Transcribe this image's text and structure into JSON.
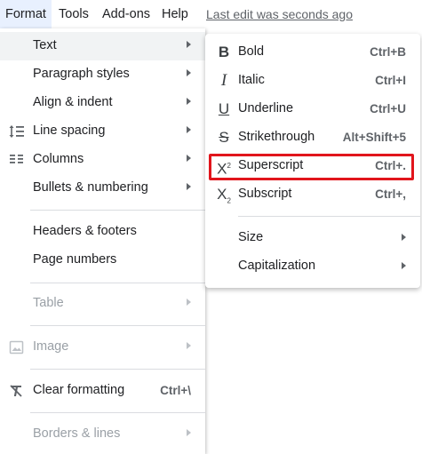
{
  "menubar": {
    "items": [
      "Format",
      "Tools",
      "Add-ons",
      "Help"
    ],
    "last_edit": "Last edit was seconds ago"
  },
  "format_menu": {
    "items": [
      {
        "label": "Text",
        "icon": "",
        "submenu": true,
        "state": "hover"
      },
      {
        "label": "Paragraph styles",
        "icon": "",
        "submenu": true
      },
      {
        "label": "Align & indent",
        "icon": "",
        "submenu": true
      },
      {
        "label": "Line spacing",
        "icon": "line-spacing-icon",
        "submenu": true
      },
      {
        "label": "Columns",
        "icon": "columns-icon",
        "submenu": true
      },
      {
        "label": "Bullets & numbering",
        "icon": "",
        "submenu": true
      },
      {
        "label": "Headers & footers",
        "icon": "",
        "submenu": false
      },
      {
        "label": "Page numbers",
        "icon": "",
        "submenu": false
      },
      {
        "label": "Table",
        "icon": "",
        "submenu": true,
        "state": "disabled"
      },
      {
        "label": "Image",
        "icon": "image-icon",
        "submenu": true,
        "state": "disabled"
      },
      {
        "label": "Clear formatting",
        "icon": "clear-formatting-icon",
        "shortcut": "Ctrl+\\"
      },
      {
        "label": "Borders & lines",
        "icon": "",
        "submenu": true,
        "state": "disabled"
      }
    ]
  },
  "text_submenu": {
    "items": [
      {
        "label": "Bold",
        "icon": "bold-icon",
        "shortcut": "Ctrl+B"
      },
      {
        "label": "Italic",
        "icon": "italic-icon",
        "shortcut": "Ctrl+I"
      },
      {
        "label": "Underline",
        "icon": "underline-icon",
        "shortcut": "Ctrl+U"
      },
      {
        "label": "Strikethrough",
        "icon": "strikethrough-icon",
        "shortcut": "Alt+Shift+5"
      },
      {
        "label": "Superscript",
        "icon": "superscript-icon",
        "shortcut": "Ctrl+.",
        "highlighted": true
      },
      {
        "label": "Subscript",
        "icon": "subscript-icon",
        "shortcut": "Ctrl+,"
      },
      {
        "label": "Size",
        "submenu": true
      },
      {
        "label": "Capitalization",
        "submenu": true
      }
    ]
  },
  "colors": {
    "accent_bg": "#e8f0fe",
    "hover_bg": "#f1f3f4",
    "highlight_border": "#e1151c",
    "disabled_text": "#9aa0a6"
  }
}
